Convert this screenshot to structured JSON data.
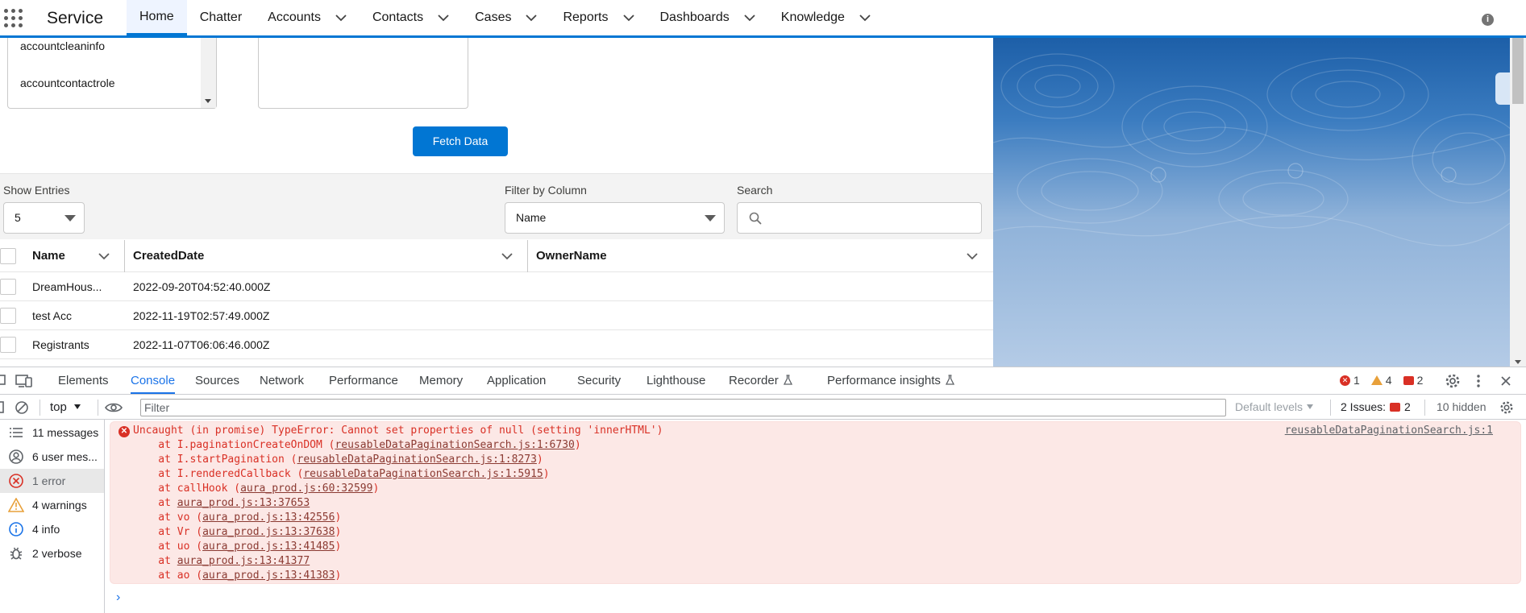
{
  "app": {
    "name": "Service",
    "nav": [
      {
        "label": "Home",
        "active": true,
        "dropdown": false
      },
      {
        "label": "Chatter",
        "active": false,
        "dropdown": false
      },
      {
        "label": "Accounts",
        "active": false,
        "dropdown": true
      },
      {
        "label": "Contacts",
        "active": false,
        "dropdown": true
      },
      {
        "label": "Cases",
        "active": false,
        "dropdown": true
      },
      {
        "label": "Reports",
        "active": false,
        "dropdown": true
      },
      {
        "label": "Dashboards",
        "active": false,
        "dropdown": true
      },
      {
        "label": "Knowledge",
        "active": false,
        "dropdown": true
      }
    ],
    "info_icon": "i"
  },
  "objects_list": {
    "options": [
      "accountcleaninfo",
      "accountcontactrole"
    ]
  },
  "fetch_button": {
    "label": "Fetch Data"
  },
  "filters": {
    "show_entries_label": "Show Entries",
    "show_entries_value": "5",
    "filter_by_column_label": "Filter by Column",
    "filter_by_column_value": "Name",
    "search_label": "Search",
    "search_placeholder": ""
  },
  "table": {
    "columns": [
      "Name",
      "CreatedDate",
      "OwnerName"
    ],
    "rows": [
      {
        "name": "DreamHous...",
        "created": "2022-09-20T04:52:40.000Z",
        "owner": ""
      },
      {
        "name": "test Acc",
        "created": "2022-11-19T02:57:49.000Z",
        "owner": ""
      },
      {
        "name": "Registrants",
        "created": "2022-11-07T06:06:46.000Z",
        "owner": ""
      }
    ]
  },
  "devtools": {
    "tabs": [
      "Elements",
      "Console",
      "Sources",
      "Network",
      "Performance",
      "Memory",
      "Application",
      "Security",
      "Lighthouse",
      "Recorder",
      "Performance insights"
    ],
    "active_tab": "Console",
    "error_count": "1",
    "warning_count": "4",
    "issue_count": "2",
    "context": "top",
    "filter_placeholder": "Filter",
    "default_levels": "Default levels",
    "issues_label": "2 Issues:",
    "issues_num": "2",
    "hidden_label": "10 hidden",
    "sidebar": [
      {
        "label": "11 messages",
        "icon": "list-icon"
      },
      {
        "label": "6 user mes...",
        "icon": "user-icon"
      },
      {
        "label": "1 error",
        "icon": "error-icon"
      },
      {
        "label": "4 warnings",
        "icon": "warning-icon"
      },
      {
        "label": "4 info",
        "icon": "info-icon"
      },
      {
        "label": "2 verbose",
        "icon": "bug-icon"
      }
    ],
    "selected_sidebar": 2,
    "error": {
      "message": "Uncaught (in promise) TypeError: Cannot set properties of null (setting 'innerHTML')",
      "source": "reusableDataPaginationSearch.js:1",
      "stack": [
        {
          "pre": "    at I.paginationCreateOnDOM (",
          "link": "reusableDataPaginationSearch.js:1:6730",
          "post": ")"
        },
        {
          "pre": "    at I.startPagination (",
          "link": "reusableDataPaginationSearch.js:1:8273",
          "post": ")"
        },
        {
          "pre": "    at I.renderedCallback (",
          "link": "reusableDataPaginationSearch.js:1:5915",
          "post": ")"
        },
        {
          "pre": "    at callHook (",
          "link": "aura_prod.js:60:32599",
          "post": ")"
        },
        {
          "pre": "    at ",
          "link": "aura_prod.js:13:37653",
          "post": ""
        },
        {
          "pre": "    at vo (",
          "link": "aura_prod.js:13:42556",
          "post": ")"
        },
        {
          "pre": "    at Vr (",
          "link": "aura_prod.js:13:37638",
          "post": ")"
        },
        {
          "pre": "    at uo (",
          "link": "aura_prod.js:13:41485",
          "post": ")"
        },
        {
          "pre": "    at ",
          "link": "aura_prod.js:13:41377",
          "post": ""
        },
        {
          "pre": "    at ao (",
          "link": "aura_prod.js:13:41383",
          "post": ")"
        }
      ]
    },
    "prompt": "›"
  }
}
